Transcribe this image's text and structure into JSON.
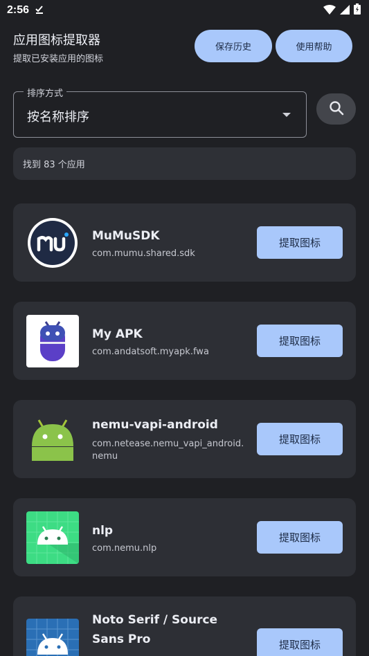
{
  "status_bar": {
    "time": "2:56"
  },
  "header": {
    "title": "应用图标提取器",
    "subtitle": "提取已安装应用的图标"
  },
  "buttons": {
    "history": "保存历史",
    "help": "使用帮助"
  },
  "sort": {
    "label": "排序方式",
    "value": "按名称排序"
  },
  "count_text": "找到 83 个应用",
  "apps": [
    {
      "name": "MuMuSDK",
      "package": "com.mumu.shared.sdk",
      "action": "提取图标",
      "icon": "mumu-logo-icon"
    },
    {
      "name": "My APK",
      "package": "com.andatsoft.myapk.fwa",
      "action": "提取图标",
      "icon": "robot-icon"
    },
    {
      "name": "nemu-vapi-android",
      "package": "com.netease.nemu_vapi_android.nemu",
      "action": "提取图标",
      "icon": "android-icon"
    },
    {
      "name": "nlp",
      "package": "com.nemu.nlp",
      "action": "提取图标",
      "icon": "android-green-icon"
    },
    {
      "name": "Noto Serif / Source Sans Pro",
      "package": "",
      "action": "提取图标",
      "icon": "android-blueprint-icon"
    }
  ],
  "colors": {
    "background": "#1f2024",
    "card": "#2d2f35",
    "accent": "#a9c8fb"
  }
}
